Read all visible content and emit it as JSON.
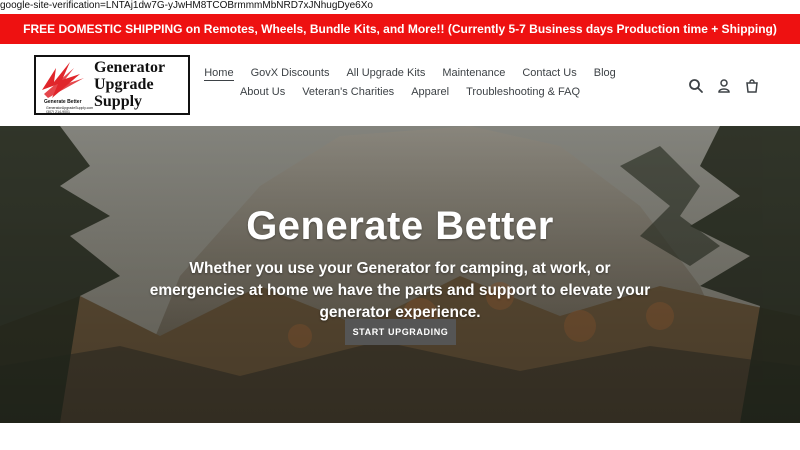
{
  "meta": {
    "verification_text": "google-site-verification=LNTAj1dw7G-yJwHM8TCOBrmmmMbNRD7xJNhugDye6Xo"
  },
  "announcement": {
    "text": "FREE DOMESTIC SHIPPING on Remotes, Wheels, Bundle Kits, and More!! (Currently 5-7 Business days Production time + Shipping)"
  },
  "logo": {
    "line1": "Generator",
    "line2": "Upgrade",
    "line3": "Supply",
    "small": "Generate Better",
    "tiny1": "GeneratorUpgradeSupply.com",
    "tiny2": "(307) 214-9001",
    "brand_color": "#e0262b"
  },
  "nav": {
    "row1": [
      "Home",
      "GovX Discounts",
      "All Upgrade Kits",
      "Maintenance",
      "Contact Us",
      "Blog"
    ],
    "row2": [
      "About Us",
      "Veteran's Charities",
      "Apparel",
      "Troubleshooting & FAQ"
    ]
  },
  "header_icons": [
    "search-icon",
    "user-icon",
    "cart-icon"
  ],
  "hero": {
    "title": "Generate Better",
    "subtitle": "Whether you use your Generator for camping, at work, or emergencies at home we have the parts and support to elevate your generator experience.",
    "cta": "START UPGRADING"
  },
  "colors": {
    "announcement_bg": "#ee1111",
    "cta_bg": "#555555"
  }
}
